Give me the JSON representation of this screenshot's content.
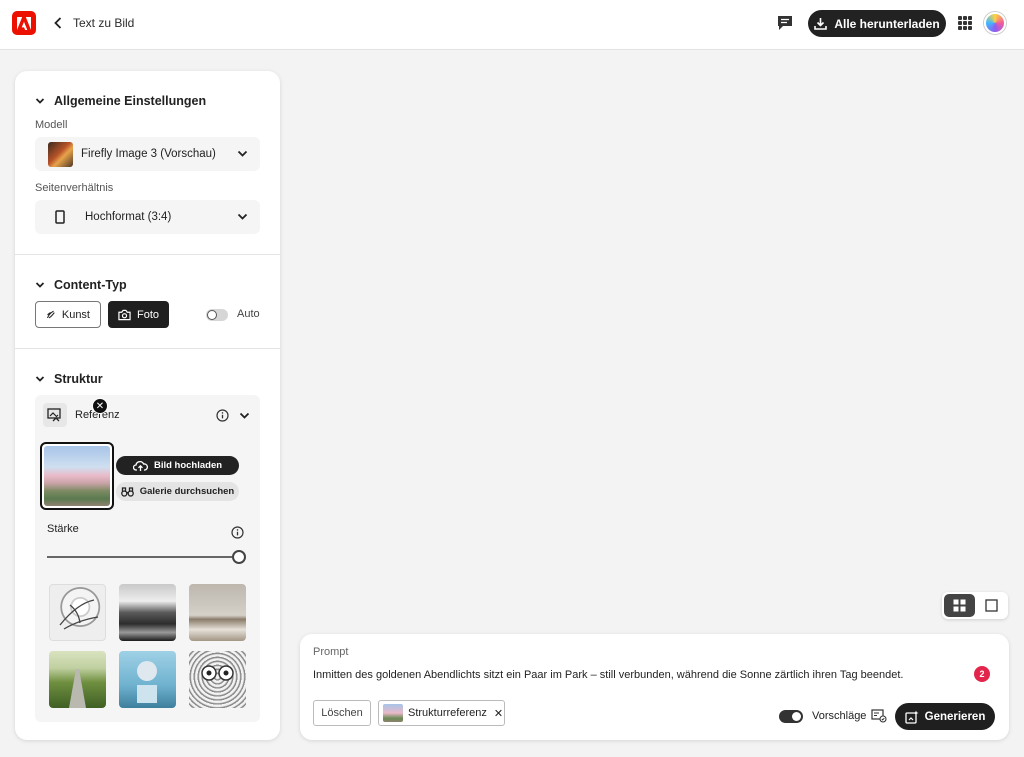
{
  "header": {
    "title": "Text zu Bild",
    "download_all_label": "Alle herunterladen",
    "logo_icon": "adobe-logo-icon",
    "brand_color": "#eb1000"
  },
  "panel": {
    "general": {
      "heading": "Allgemeine Einstellungen",
      "model_label": "Modell",
      "model_value": "Firefly Image 3 (Vorschau)",
      "aspect_label": "Seitenverhältnis",
      "aspect_value": "Hochformat (3:4)"
    },
    "content_type": {
      "heading": "Content-Typ",
      "art_label": "Kunst",
      "photo_label": "Foto",
      "selected": "Foto",
      "auto_label": "Auto",
      "auto_enabled": false
    },
    "structure": {
      "heading": "Struktur",
      "reference_label": "Referenz",
      "upload_label": "Bild hochladen",
      "gallery_label": "Galerie durchsuchen",
      "strength_label": "Stärke",
      "strength_value": 1.0,
      "presets": [
        {
          "icon": "bird-sketch-preset"
        },
        {
          "icon": "mountain-valley-preset"
        },
        {
          "icon": "living-room-preset"
        },
        {
          "icon": "field-road-preset"
        },
        {
          "icon": "sphere-cube-preset"
        },
        {
          "icon": "owl-sketch-preset"
        }
      ]
    }
  },
  "prompt": {
    "label": "Prompt",
    "text": "Inmitten des goldenen Abendlichts sitzt ein Paar im Park – still verbunden, während  die Sonne zärtlich ihren Tag beendet.",
    "badge_count": "2",
    "clear_label": "Löschen",
    "chip_label": "Strukturreferenz",
    "suggestions_label": "Vorschläge",
    "suggestions_enabled": true,
    "generate_label": "Generieren"
  }
}
